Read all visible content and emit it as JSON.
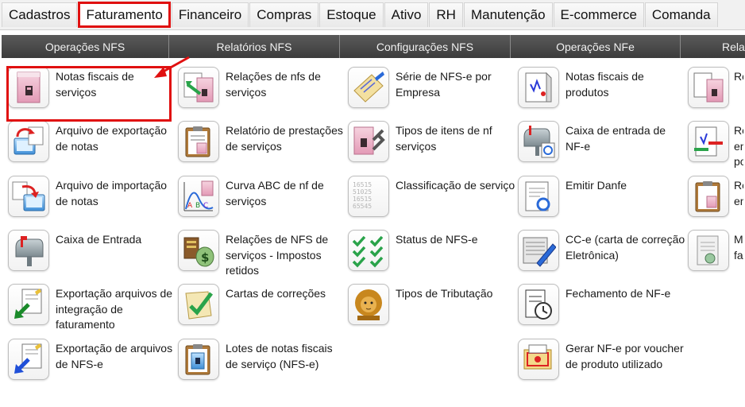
{
  "tabs": [
    {
      "label": "Cadastros"
    },
    {
      "label": "Faturamento"
    },
    {
      "label": "Financeiro"
    },
    {
      "label": "Compras"
    },
    {
      "label": "Estoque"
    },
    {
      "label": "Ativo"
    },
    {
      "label": "RH"
    },
    {
      "label": "Manutenção"
    },
    {
      "label": "E-commerce"
    },
    {
      "label": "Comanda"
    }
  ],
  "active_tab": "Faturamento",
  "sections": [
    {
      "title": "Operações NFS"
    },
    {
      "title": "Relatórios NFS"
    },
    {
      "title": "Configurações NFS"
    },
    {
      "title": "Operações NFe"
    },
    {
      "title": "Rela"
    }
  ],
  "columns": [
    {
      "items": [
        {
          "label": "Notas fiscais de serviços",
          "icon": "invoice-pink-icon"
        },
        {
          "label": "Arquivo de exportação de notas",
          "icon": "export-file-icon"
        },
        {
          "label": "Arquivo de importação de notas",
          "icon": "import-file-icon"
        },
        {
          "label": "Caixa de Entrada",
          "icon": "mailbox-icon"
        },
        {
          "label": "Exportação arquivos de integração de faturamento",
          "icon": "export-integration-icon"
        },
        {
          "label": "Exportação de arquivos de NFS-e",
          "icon": "export-nfse-icon"
        }
      ]
    },
    {
      "items": [
        {
          "label": "Relações de nfs de serviços",
          "icon": "invoice-relations-icon"
        },
        {
          "label": "Relatório de prestações de serviços",
          "icon": "clipboard-report-icon"
        },
        {
          "label": "Curva ABC de nf de serviços",
          "icon": "abc-curve-icon"
        },
        {
          "label": "Relações de NFS de serviços - Impostos retidos",
          "icon": "tax-money-icon"
        },
        {
          "label": "Cartas de correções",
          "icon": "correction-check-icon"
        },
        {
          "label": "Lotes de notas fiscais de serviço (NFS-e)",
          "icon": "batch-invoice-icon"
        }
      ]
    },
    {
      "items": [
        {
          "label": "Série de NFS-e por Empresa",
          "icon": "series-notepad-icon"
        },
        {
          "label": "Tipos de itens de nf serviços",
          "icon": "item-types-icon"
        },
        {
          "label": "Classificação de serviço",
          "icon": "classification-numbers-icon"
        },
        {
          "label": "Status de NFS-e",
          "icon": "status-checks-icon"
        },
        {
          "label": "Tipos de Tributação",
          "icon": "lion-icon"
        }
      ]
    },
    {
      "items": [
        {
          "label": "Notas fiscais de produtos",
          "icon": "product-invoice-icon"
        },
        {
          "label": "Caixa de entrada de NF-e",
          "icon": "nfe-mailbox-icon"
        },
        {
          "label": "Emitir Danfe",
          "icon": "danfe-icon"
        },
        {
          "label": "CC-e (carta de correção Eletrônica)",
          "icon": "cce-letter-icon"
        },
        {
          "label": "Fechamento de NF-e",
          "icon": "closing-clock-icon"
        },
        {
          "label": "Gerar NF-e por voucher de produto utilizado",
          "icon": "voucher-icon"
        }
      ]
    },
    {
      "items": [
        {
          "label": "Re",
          "icon": "report-a-icon"
        },
        {
          "label": "Re en po",
          "icon": "report-b-icon"
        },
        {
          "label": "Re en",
          "icon": "report-c-icon"
        },
        {
          "label": "M fa",
          "icon": "report-d-icon"
        }
      ]
    }
  ],
  "colors": {
    "highlight": "#e01010",
    "section_bg": "#4a4a4a",
    "invoice_pink": "#e9a9c0"
  }
}
